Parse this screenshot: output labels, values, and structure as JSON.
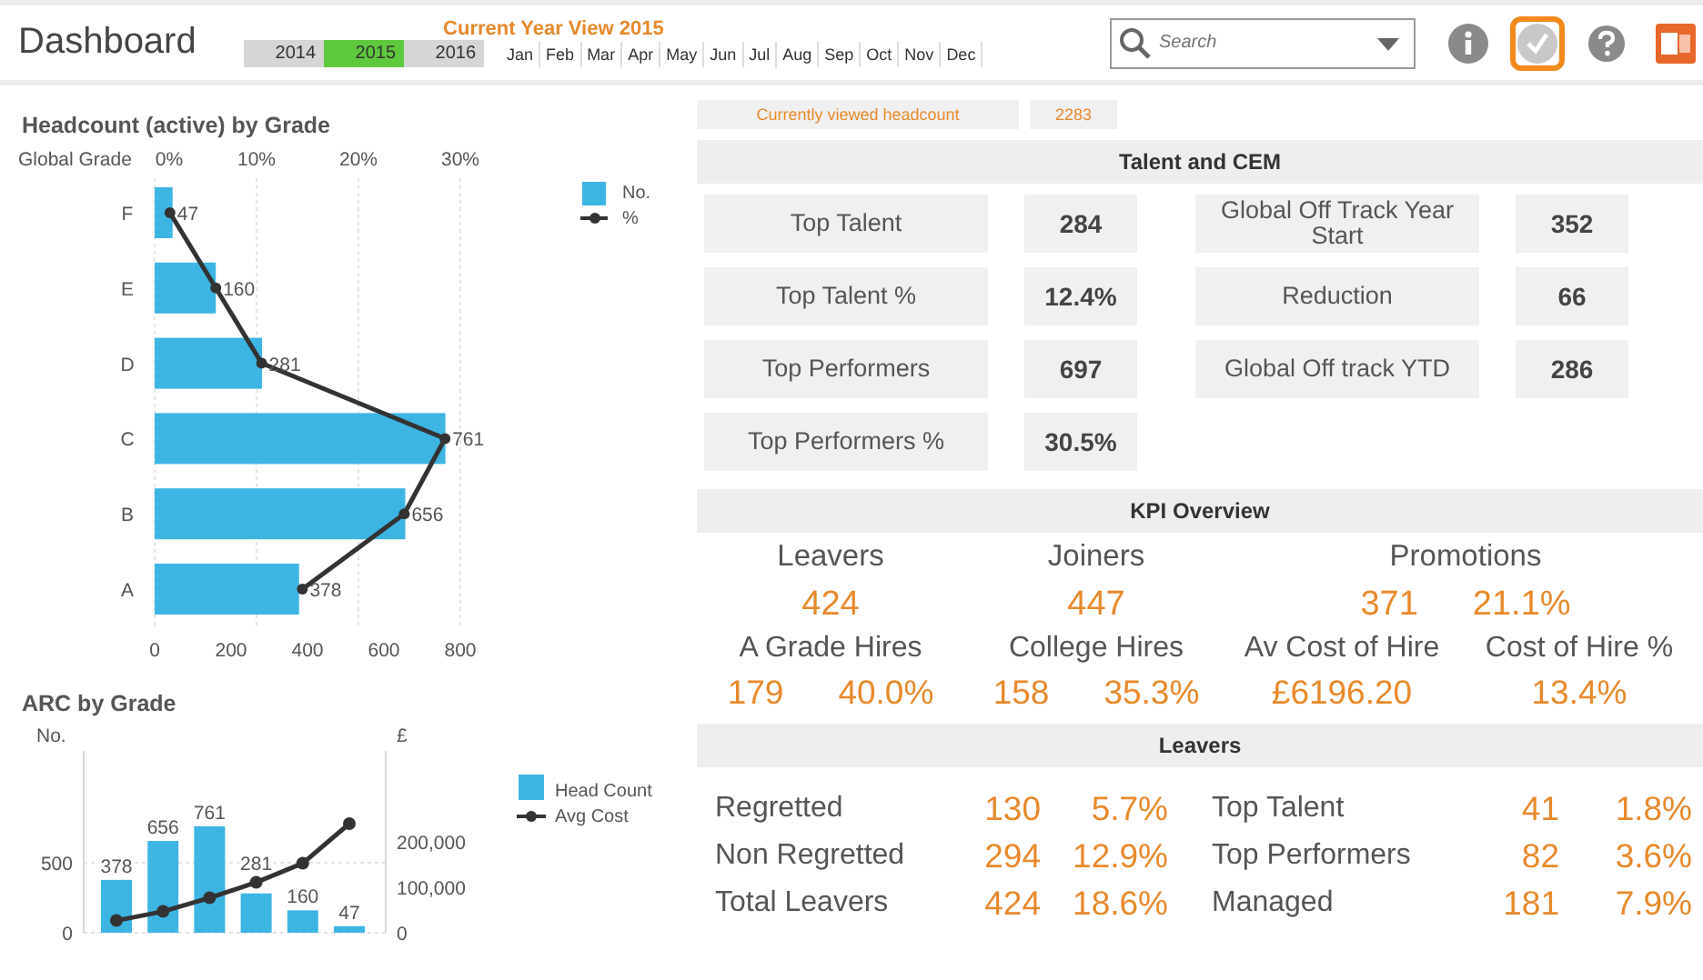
{
  "header": {
    "title": "Dashboard",
    "year_view_title": "Current Year View 2015",
    "years": [
      {
        "label": "2014",
        "selected": false
      },
      {
        "label": "2015",
        "selected": true
      },
      {
        "label": "2016",
        "selected": false
      }
    ],
    "months": [
      {
        "label": "Jan",
        "selected": false
      },
      {
        "label": "Feb",
        "selected": false
      },
      {
        "label": "Mar",
        "selected": false
      },
      {
        "label": "Apr",
        "selected": false
      },
      {
        "label": "May",
        "selected": false
      },
      {
        "label": "Jun",
        "selected": false
      },
      {
        "label": "Jul",
        "selected": false
      },
      {
        "label": "Aug",
        "selected": false
      },
      {
        "label": "Sep",
        "selected": false
      },
      {
        "label": "Oct",
        "selected": false
      },
      {
        "label": "Nov",
        "selected": false
      },
      {
        "label": "Dec",
        "selected": false
      }
    ],
    "search": {
      "placeholder": "Search"
    },
    "toolbar": [
      {
        "kind": "info",
        "selected": false
      },
      {
        "kind": "check",
        "selected": true
      },
      {
        "kind": "help",
        "selected": false
      },
      {
        "kind": "powerpoint",
        "selected": false
      }
    ]
  },
  "headcount_chart": {
    "title": "Headcount (active) by Grade",
    "chart_data": {
      "type": "bar",
      "orientation": "horizontal",
      "ylabel": "Global Grade",
      "categories": [
        "F",
        "E",
        "D",
        "C",
        "B",
        "A"
      ],
      "series": [
        {
          "name": "No.",
          "color": "#3db5e3",
          "values": [
            47,
            160,
            281,
            761,
            656,
            378
          ]
        },
        {
          "name": "%",
          "color": "#333333",
          "type": "line",
          "axis": "x2",
          "marker": "circle",
          "values": [
            1.5,
            6,
            10.5,
            28.5,
            24.5,
            14.5
          ]
        }
      ],
      "xticks": [
        0,
        200,
        400,
        600,
        800
      ],
      "xlim": [
        0,
        800
      ],
      "x2lim": [
        0,
        30
      ],
      "grid": true,
      "legend": "right",
      "x2ticks": [
        {
          "value": 0,
          "label": "0%"
        },
        {
          "value": 10,
          "label": "10%"
        },
        {
          "value": 20,
          "label": "20%"
        },
        {
          "value": 30,
          "label": "30%"
        }
      ],
      "value_labels": [
        "47",
        "160",
        "281",
        "761",
        "656",
        "378"
      ]
    }
  },
  "arc_chart": {
    "title": "ARC by Grade",
    "chart_data": {
      "type": "bar",
      "ylabel": "No.",
      "y2label": "£",
      "series": [
        {
          "name": "Head Count",
          "color": "#3db5e3",
          "values": [
            378,
            656,
            761,
            281,
            160,
            47
          ]
        },
        {
          "name": "Avg Cost",
          "color": "#333333",
          "type": "line",
          "axis": "y2",
          "marker": "circle",
          "values": [
            27000,
            47000,
            77000,
            111000,
            153000,
            240000
          ]
        }
      ],
      "yticks": [
        0,
        500
      ],
      "ylim": [
        0,
        1300
      ],
      "y2lim": [
        0,
        400000
      ],
      "y2ticks": [
        {
          "value": 0,
          "label": "0"
        },
        {
          "value": 100000,
          "label": "100,000"
        },
        {
          "value": 200000,
          "label": "200,000"
        }
      ],
      "grid": true,
      "legend": "right",
      "value_labels": [
        "378",
        "656",
        "761",
        "281",
        "160",
        "47"
      ]
    }
  },
  "current_headcount": {
    "label": "Currently viewed headcount",
    "value": "2283"
  },
  "talent": {
    "title": "Talent and CEM",
    "left": [
      {
        "label": "Top Talent",
        "value": "284"
      },
      {
        "label": "Top Talent %",
        "value": "12.4%"
      },
      {
        "label": "Top Performers",
        "value": "697"
      },
      {
        "label": "Top Performers %",
        "value": "30.5%"
      }
    ],
    "right": [
      {
        "label": "Global Off Track Year Start",
        "value": "352"
      },
      {
        "label": "Reduction",
        "value": "66"
      },
      {
        "label": "Global Off track YTD",
        "value": "286"
      }
    ]
  },
  "kpi": {
    "title": "KPI Overview",
    "rows": [
      [
        {
          "label": "Leavers",
          "values": [
            "424"
          ]
        },
        {
          "label": "Joiners",
          "values": [
            "447"
          ]
        },
        {
          "label": "Promotions",
          "values": [
            "371",
            "21.1%"
          ]
        }
      ],
      [
        {
          "label": "A Grade Hires",
          "values": [
            "179",
            "40.0%"
          ]
        },
        {
          "label": "College Hires",
          "values": [
            "158",
            "35.3%"
          ]
        },
        {
          "label": "Av Cost of Hire",
          "values": [
            "£6196.20"
          ]
        },
        {
          "label": "Cost of Hire %",
          "values": [
            "13.4%"
          ]
        }
      ]
    ]
  },
  "leavers": {
    "title": "Leavers",
    "left": [
      {
        "label": "Regretted",
        "count": "130",
        "pct": "5.7%"
      },
      {
        "label": "Non Regretted",
        "count": "294",
        "pct": "12.9%"
      },
      {
        "label": "Total Leavers",
        "count": "424",
        "pct": "18.6%"
      }
    ],
    "right": [
      {
        "label": "Top Talent",
        "count": "41",
        "pct": "1.8%"
      },
      {
        "label": "Top Performers",
        "count": "82",
        "pct": "3.6%"
      },
      {
        "label": "Managed",
        "count": "181",
        "pct": "7.9%"
      }
    ]
  }
}
